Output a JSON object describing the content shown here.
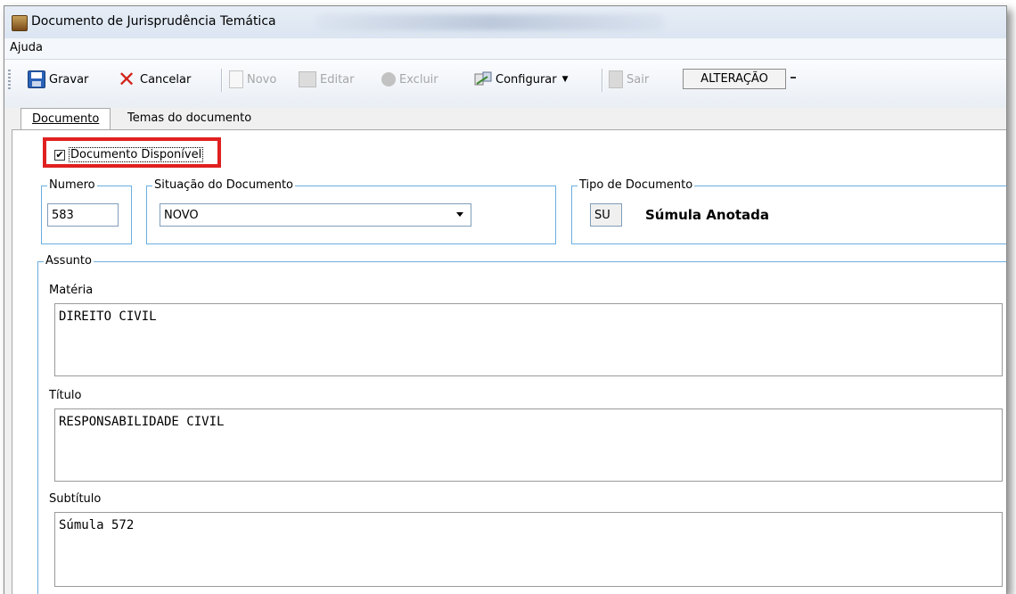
{
  "window": {
    "title": "Documento de Jurisprudência Temática"
  },
  "menu": {
    "items": [
      "Ajuda"
    ]
  },
  "toolbar": {
    "gravar": "Gravar",
    "cancelar": "Cancelar",
    "novo": "Novo",
    "editar": "Editar",
    "excluir": "Excluir",
    "configurar": "Configurar",
    "sair": "Sair",
    "mode": "ALTERAÇÃO"
  },
  "tabs": [
    {
      "label": "Documento",
      "active": true
    },
    {
      "label": "Temas do documento",
      "active": false
    }
  ],
  "form": {
    "documento_disponivel": {
      "label": "Documento Disponível",
      "checked": true
    },
    "numero": {
      "title": "Numero",
      "value": "583"
    },
    "situacao": {
      "title": "Situação do Documento",
      "value": "NOVO"
    },
    "tipo": {
      "title": "Tipo de Documento",
      "code": "SU",
      "name": "Súmula Anotada"
    },
    "assunto": {
      "title": "Assunto",
      "materia": {
        "label": "Matéria",
        "value": "DIREITO CIVIL"
      },
      "titulo": {
        "label": "Título",
        "value": "RESPONSABILIDADE CIVIL"
      },
      "subtitulo": {
        "label": "Subtítulo",
        "value": "Súmula 572"
      }
    }
  },
  "colors": {
    "highlight": "#e02020",
    "group_border": "#6aaee0"
  }
}
